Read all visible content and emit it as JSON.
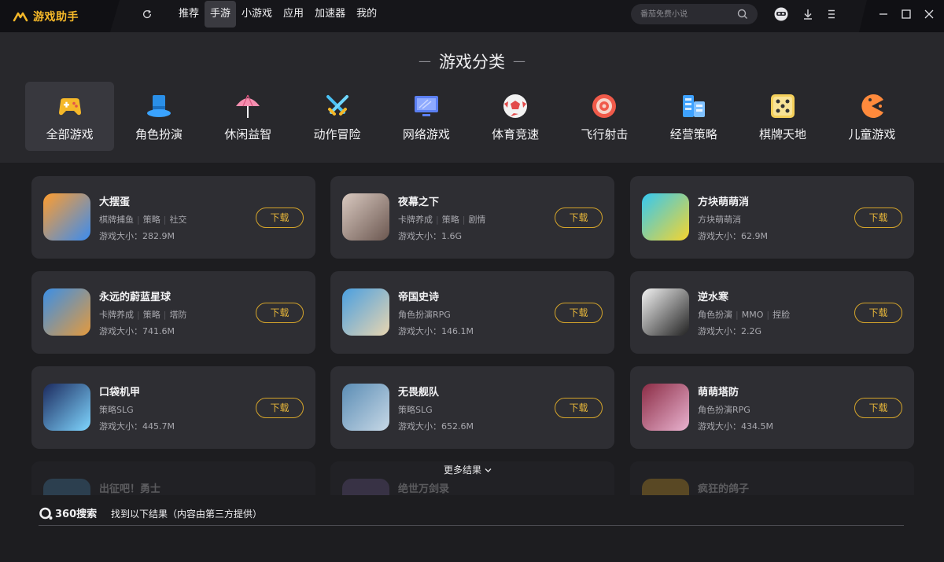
{
  "app": {
    "title": "游戏助手",
    "accent": "#f5b829"
  },
  "nav": {
    "items": [
      "推荐",
      "手游",
      "小游戏",
      "应用",
      "加速器",
      "我的"
    ],
    "active_index": 1
  },
  "search": {
    "placeholder": "番茄免费小说"
  },
  "categories": {
    "title": "游戏分类",
    "items": [
      {
        "label": "全部游戏",
        "icon": "gamepad-icon",
        "active": true
      },
      {
        "label": "角色扮演",
        "icon": "top-hat-icon"
      },
      {
        "label": "休闲益智",
        "icon": "umbrella-icon"
      },
      {
        "label": "动作冒险",
        "icon": "crossed-swords-icon"
      },
      {
        "label": "网络游戏",
        "icon": "monitor-icon"
      },
      {
        "label": "体育竞速",
        "icon": "soccer-ball-icon"
      },
      {
        "label": "飞行射击",
        "icon": "target-icon"
      },
      {
        "label": "经营策略",
        "icon": "buildings-icon"
      },
      {
        "label": "棋牌天地",
        "icon": "dice-icon"
      },
      {
        "label": "儿童游戏",
        "icon": "pacman-icon"
      }
    ]
  },
  "games": [
    {
      "name": "大摆蛋",
      "tags": [
        "棋牌捕鱼",
        "策略",
        "社交"
      ],
      "size": "游戏大小：282.9M",
      "button": "下载",
      "icon_colors": [
        "#ff9d2e",
        "#3b8cf0"
      ]
    },
    {
      "name": "夜幕之下",
      "tags": [
        "卡牌养成",
        "策略",
        "剧情"
      ],
      "size": "游戏大小：1.6G",
      "button": "下载",
      "icon_colors": [
        "#d9c9c0",
        "#6b5750"
      ]
    },
    {
      "name": "方块萌萌消",
      "tags": [
        "方块萌萌消"
      ],
      "size": "游戏大小：62.9M",
      "button": "下载",
      "icon_colors": [
        "#34c8f2",
        "#f6d52e"
      ]
    },
    {
      "name": "永远的蔚蓝星球",
      "tags": [
        "卡牌养成",
        "策略",
        "塔防"
      ],
      "size": "游戏大小：741.6M",
      "button": "下载",
      "icon_colors": [
        "#3b8fe6",
        "#e49a3d"
      ]
    },
    {
      "name": "帝国史诗",
      "tags": [
        "角色扮演RPG"
      ],
      "size": "游戏大小：146.1M",
      "button": "下载",
      "icon_colors": [
        "#4a9fe0",
        "#e8d5b0"
      ]
    },
    {
      "name": "逆水寒",
      "tags": [
        "角色扮演",
        "MMO",
        "捏脸"
      ],
      "size": "游戏大小：2.2G",
      "button": "下载",
      "icon_colors": [
        "#f2f2f2",
        "#222222"
      ]
    },
    {
      "name": "口袋机甲",
      "tags": [
        "策略SLG"
      ],
      "size": "游戏大小：445.7M",
      "button": "下载",
      "icon_colors": [
        "#1c2a5e",
        "#7fd6ff"
      ]
    },
    {
      "name": "无畏舰队",
      "tags": [
        "策略SLG"
      ],
      "size": "游戏大小：652.6M",
      "button": "下载",
      "icon_colors": [
        "#5b8db5",
        "#c7d8e6"
      ]
    },
    {
      "name": "萌萌塔防",
      "tags": [
        "角色扮演RPG"
      ],
      "size": "游戏大小：434.5M",
      "button": "下载",
      "icon_colors": [
        "#8b2c45",
        "#e9b3d0"
      ]
    }
  ],
  "partial_games": [
    "出征吧！勇士",
    "绝世万剑录",
    "疯狂的鸽子"
  ],
  "more": {
    "label": "更多结果"
  },
  "search_engine": {
    "name": "360搜索",
    "note": "找到以下结果（内容由第三方提供）"
  }
}
